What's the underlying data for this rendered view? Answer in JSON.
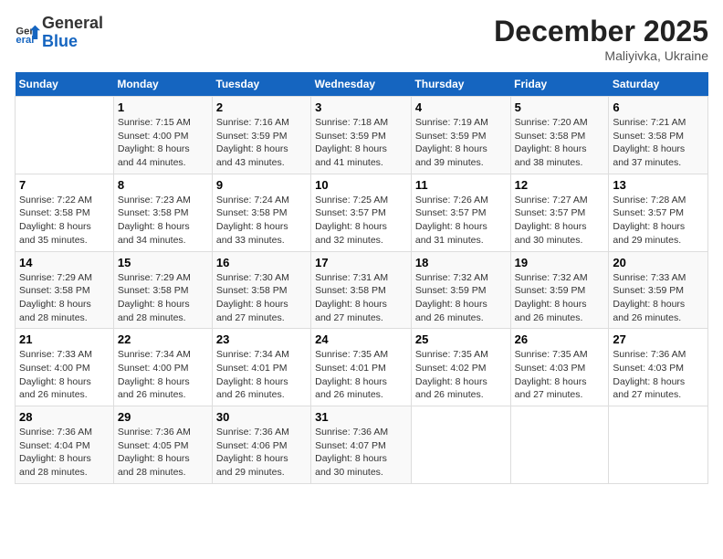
{
  "logo": {
    "line1": "General",
    "line2": "Blue"
  },
  "header": {
    "title": "December 2025",
    "subtitle": "Maliyivka, Ukraine"
  },
  "days_of_week": [
    "Sunday",
    "Monday",
    "Tuesday",
    "Wednesday",
    "Thursday",
    "Friday",
    "Saturday"
  ],
  "weeks": [
    [
      {
        "day": "",
        "info": ""
      },
      {
        "day": "1",
        "info": "Sunrise: 7:15 AM\nSunset: 4:00 PM\nDaylight: 8 hours\nand 44 minutes."
      },
      {
        "day": "2",
        "info": "Sunrise: 7:16 AM\nSunset: 3:59 PM\nDaylight: 8 hours\nand 43 minutes."
      },
      {
        "day": "3",
        "info": "Sunrise: 7:18 AM\nSunset: 3:59 PM\nDaylight: 8 hours\nand 41 minutes."
      },
      {
        "day": "4",
        "info": "Sunrise: 7:19 AM\nSunset: 3:59 PM\nDaylight: 8 hours\nand 39 minutes."
      },
      {
        "day": "5",
        "info": "Sunrise: 7:20 AM\nSunset: 3:58 PM\nDaylight: 8 hours\nand 38 minutes."
      },
      {
        "day": "6",
        "info": "Sunrise: 7:21 AM\nSunset: 3:58 PM\nDaylight: 8 hours\nand 37 minutes."
      }
    ],
    [
      {
        "day": "7",
        "info": "Sunrise: 7:22 AM\nSunset: 3:58 PM\nDaylight: 8 hours\nand 35 minutes."
      },
      {
        "day": "8",
        "info": "Sunrise: 7:23 AM\nSunset: 3:58 PM\nDaylight: 8 hours\nand 34 minutes."
      },
      {
        "day": "9",
        "info": "Sunrise: 7:24 AM\nSunset: 3:58 PM\nDaylight: 8 hours\nand 33 minutes."
      },
      {
        "day": "10",
        "info": "Sunrise: 7:25 AM\nSunset: 3:57 PM\nDaylight: 8 hours\nand 32 minutes."
      },
      {
        "day": "11",
        "info": "Sunrise: 7:26 AM\nSunset: 3:57 PM\nDaylight: 8 hours\nand 31 minutes."
      },
      {
        "day": "12",
        "info": "Sunrise: 7:27 AM\nSunset: 3:57 PM\nDaylight: 8 hours\nand 30 minutes."
      },
      {
        "day": "13",
        "info": "Sunrise: 7:28 AM\nSunset: 3:57 PM\nDaylight: 8 hours\nand 29 minutes."
      }
    ],
    [
      {
        "day": "14",
        "info": "Sunrise: 7:29 AM\nSunset: 3:58 PM\nDaylight: 8 hours\nand 28 minutes."
      },
      {
        "day": "15",
        "info": "Sunrise: 7:29 AM\nSunset: 3:58 PM\nDaylight: 8 hours\nand 28 minutes."
      },
      {
        "day": "16",
        "info": "Sunrise: 7:30 AM\nSunset: 3:58 PM\nDaylight: 8 hours\nand 27 minutes."
      },
      {
        "day": "17",
        "info": "Sunrise: 7:31 AM\nSunset: 3:58 PM\nDaylight: 8 hours\nand 27 minutes."
      },
      {
        "day": "18",
        "info": "Sunrise: 7:32 AM\nSunset: 3:59 PM\nDaylight: 8 hours\nand 26 minutes."
      },
      {
        "day": "19",
        "info": "Sunrise: 7:32 AM\nSunset: 3:59 PM\nDaylight: 8 hours\nand 26 minutes."
      },
      {
        "day": "20",
        "info": "Sunrise: 7:33 AM\nSunset: 3:59 PM\nDaylight: 8 hours\nand 26 minutes."
      }
    ],
    [
      {
        "day": "21",
        "info": "Sunrise: 7:33 AM\nSunset: 4:00 PM\nDaylight: 8 hours\nand 26 minutes."
      },
      {
        "day": "22",
        "info": "Sunrise: 7:34 AM\nSunset: 4:00 PM\nDaylight: 8 hours\nand 26 minutes."
      },
      {
        "day": "23",
        "info": "Sunrise: 7:34 AM\nSunset: 4:01 PM\nDaylight: 8 hours\nand 26 minutes."
      },
      {
        "day": "24",
        "info": "Sunrise: 7:35 AM\nSunset: 4:01 PM\nDaylight: 8 hours\nand 26 minutes."
      },
      {
        "day": "25",
        "info": "Sunrise: 7:35 AM\nSunset: 4:02 PM\nDaylight: 8 hours\nand 26 minutes."
      },
      {
        "day": "26",
        "info": "Sunrise: 7:35 AM\nSunset: 4:03 PM\nDaylight: 8 hours\nand 27 minutes."
      },
      {
        "day": "27",
        "info": "Sunrise: 7:36 AM\nSunset: 4:03 PM\nDaylight: 8 hours\nand 27 minutes."
      }
    ],
    [
      {
        "day": "28",
        "info": "Sunrise: 7:36 AM\nSunset: 4:04 PM\nDaylight: 8 hours\nand 28 minutes."
      },
      {
        "day": "29",
        "info": "Sunrise: 7:36 AM\nSunset: 4:05 PM\nDaylight: 8 hours\nand 28 minutes."
      },
      {
        "day": "30",
        "info": "Sunrise: 7:36 AM\nSunset: 4:06 PM\nDaylight: 8 hours\nand 29 minutes."
      },
      {
        "day": "31",
        "info": "Sunrise: 7:36 AM\nSunset: 4:07 PM\nDaylight: 8 hours\nand 30 minutes."
      },
      {
        "day": "",
        "info": ""
      },
      {
        "day": "",
        "info": ""
      },
      {
        "day": "",
        "info": ""
      }
    ]
  ]
}
